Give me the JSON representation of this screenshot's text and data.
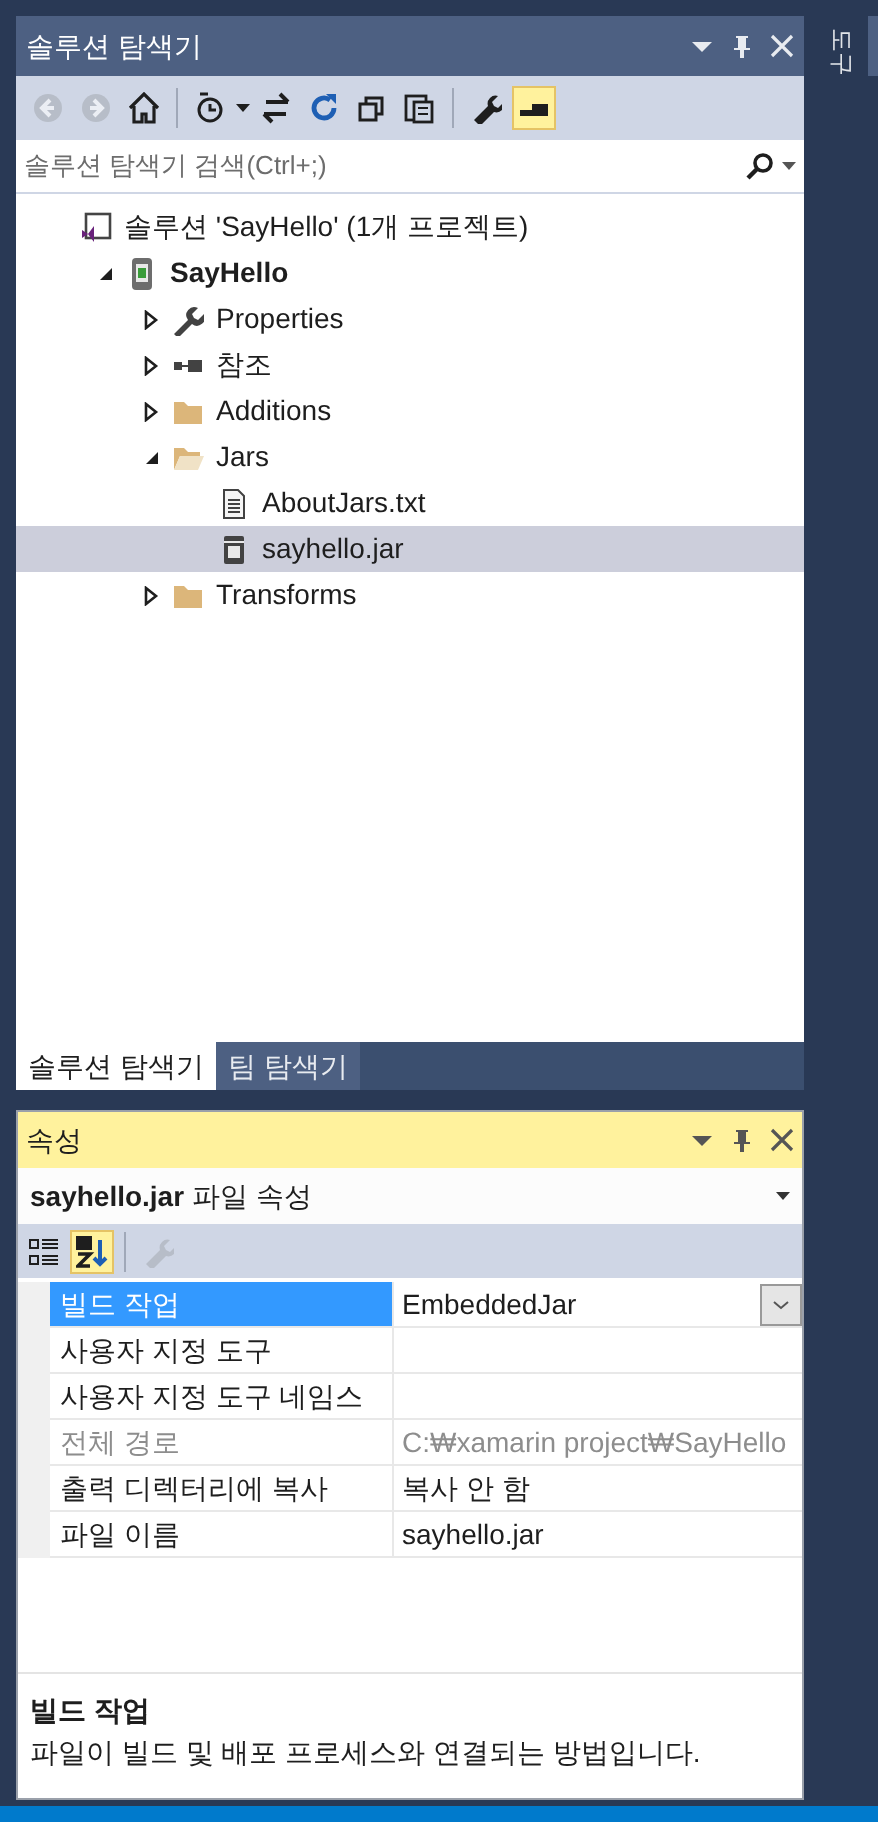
{
  "side_tab": {
    "label": "도구"
  },
  "explorer": {
    "title": "솔루션 탐색기",
    "toolbar": [
      {
        "kind": "back",
        "disabled": true,
        "on": false
      },
      {
        "kind": "forward",
        "disabled": true,
        "on": false
      },
      {
        "kind": "home",
        "disabled": false,
        "on": false
      },
      {
        "kind": "pending",
        "disabled": false,
        "on": false
      },
      {
        "kind": "sync",
        "disabled": false,
        "on": false
      },
      {
        "kind": "refresh",
        "disabled": false,
        "on": false
      },
      {
        "kind": "collapse",
        "disabled": false,
        "on": false
      },
      {
        "kind": "copy",
        "disabled": false,
        "on": false
      },
      {
        "kind": "wrench",
        "disabled": false,
        "on": false
      },
      {
        "kind": "preview",
        "disabled": false,
        "on": true
      }
    ],
    "search": {
      "placeholder": "솔루션 탐색기 검색(Ctrl+;)"
    },
    "tree": [
      {
        "kind": "solution",
        "label": "솔루션 'SayHello' (1개 프로젝트)",
        "selected": false,
        "children": [
          {
            "kind": "project",
            "label": "SayHello",
            "selected": false,
            "expanded": true,
            "children": [
              {
                "kind": "properties",
                "label": "Properties",
                "selected": false,
                "expanded": false
              },
              {
                "kind": "references",
                "label": "참조",
                "selected": false,
                "expanded": false
              },
              {
                "kind": "folder",
                "label": "Additions",
                "selected": false,
                "expanded": false
              },
              {
                "kind": "folder",
                "label": "Jars",
                "selected": false,
                "expanded": true,
                "children": [
                  {
                    "kind": "file",
                    "label": "AboutJars.txt",
                    "selected": false
                  },
                  {
                    "kind": "jar",
                    "label": "sayhello.jar",
                    "selected": true
                  }
                ]
              },
              {
                "kind": "folder",
                "label": "Transforms",
                "selected": false,
                "expanded": false
              }
            ]
          }
        ]
      }
    ],
    "tabs": [
      {
        "label": "솔루션 탐색기",
        "selected": true
      },
      {
        "label": "팀 탐색기",
        "selected": false
      }
    ]
  },
  "properties": {
    "title": "속성",
    "object": {
      "name": "sayhello.jar",
      "type": "파일 속성"
    },
    "toolbar": [
      {
        "kind": "categorized",
        "disabled": false,
        "on": false
      },
      {
        "kind": "alphabetical",
        "disabled": false,
        "on": true
      },
      {
        "kind": "pages",
        "disabled": true,
        "on": false
      }
    ],
    "rows": [
      {
        "name": "빌드 작업",
        "value": "EmbeddedJar",
        "selected": true,
        "disabled": false,
        "dropdown": true
      },
      {
        "name": "사용자 지정 도구",
        "selected": false,
        "disabled": false,
        "dropdown": false
      },
      {
        "name": "사용자 지정 도구 네임스",
        "selected": false,
        "disabled": false,
        "dropdown": false
      },
      {
        "name": "전체 경로",
        "value": "C:₩xamarin project₩SayHello",
        "selected": false,
        "disabled": true,
        "dropdown": false
      },
      {
        "name": "출력 디렉터리에 복사",
        "value": "복사 안 함",
        "selected": false,
        "disabled": false,
        "dropdown": false
      },
      {
        "name": "파일 이름",
        "value": "sayhello.jar",
        "selected": false,
        "disabled": false,
        "dropdown": false
      }
    ],
    "description": {
      "title": "빌드 작업",
      "text": "파일이 빌드 및 배포 프로세스와 연결되는 방법입니다."
    }
  }
}
